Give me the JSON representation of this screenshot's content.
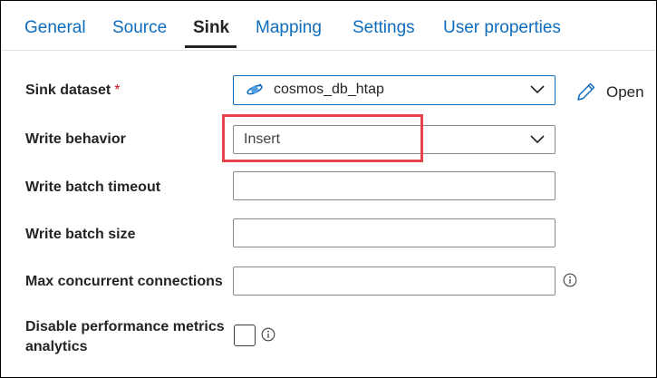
{
  "tabs": [
    {
      "label": "General"
    },
    {
      "label": "Source"
    },
    {
      "label": "Sink",
      "active": true
    },
    {
      "label": "Mapping"
    },
    {
      "label": "Settings"
    },
    {
      "label": "User properties"
    }
  ],
  "sink_dataset": {
    "label": "Sink dataset",
    "required_mark": "*",
    "value": "cosmos_db_htap",
    "icon": "cosmos-db-icon",
    "open_label": "Open"
  },
  "write_behavior": {
    "label": "Write behavior",
    "value": "Insert"
  },
  "write_batch_timeout": {
    "label": "Write batch timeout",
    "value": ""
  },
  "write_batch_size": {
    "label": "Write batch size",
    "value": ""
  },
  "max_concurrent_connections": {
    "label": "Max concurrent connections",
    "value": ""
  },
  "disable_perf_metrics": {
    "label": "Disable performance metrics analytics",
    "checked": false
  },
  "colors": {
    "link": "#0f6cbd",
    "highlight": "#e8434b",
    "required": "#c50f1f"
  }
}
